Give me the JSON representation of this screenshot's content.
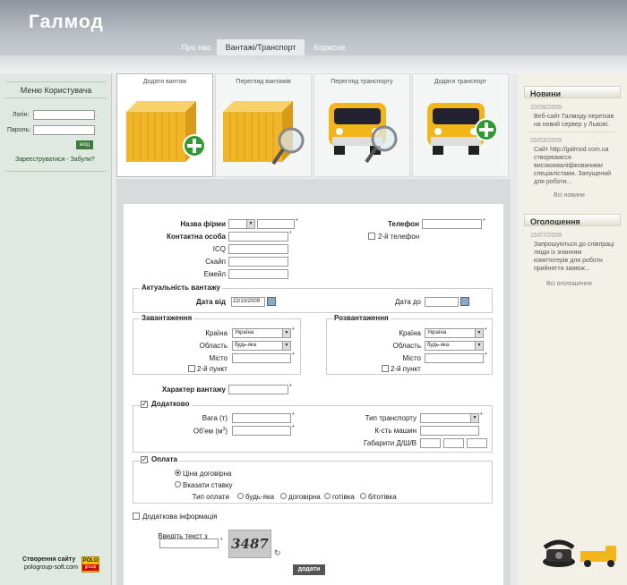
{
  "site": {
    "logo": "Галмод"
  },
  "nav": {
    "items": [
      "Про нас",
      "Вантажі/Транспорт",
      "Корисне"
    ]
  },
  "login": {
    "title": "Меню Користувача",
    "login_label": "Логін:",
    "password_label": "Пароль:",
    "submit": "вхід",
    "register": "Зареєструватися",
    "separator": "-",
    "forgot": "Забули?"
  },
  "footer": {
    "created": "Створення сайту",
    "site": "pologroup-soft.com",
    "badge_top": "POLO",
    "badge_bottom": "group"
  },
  "tiles": [
    {
      "label": "Додати вантаж",
      "icon": "container-add-icon"
    },
    {
      "label": "Перегляд вантажів",
      "icon": "container-search-icon"
    },
    {
      "label": "Перегляд транспорту",
      "icon": "truck-search-icon"
    },
    {
      "label": "Додати транспорт",
      "icon": "truck-add-icon"
    }
  ],
  "form": {
    "firm_label": "Назва фірми",
    "phone_label": "Телефон",
    "contact_label": "Контактна особа",
    "phone2_label": "2-й телефон",
    "icq_label": "ICQ",
    "skype_label": "Скайп",
    "email_label": "Емейл",
    "actuality": {
      "title": "Актуальність вантажу",
      "from_label": "Дата від",
      "from_value": "22/10/2009",
      "to_label": "Дата до"
    },
    "loading": {
      "title": "Завантаження",
      "country_label": "Країна",
      "country_value": "Україна",
      "region_label": "Область",
      "region_value": "будь-яка",
      "city_label": "Місто",
      "point2_label": "2-й пункт"
    },
    "unloading": {
      "title": "Розвантаження",
      "country_label": "Країна",
      "country_value": "Україна",
      "region_label": "Область",
      "region_value": "будь-яка",
      "city_label": "Місто",
      "point2_label": "2-й пункт"
    },
    "cargo_label": "Характер вантажу",
    "extra": {
      "title": "Додатково",
      "weight_label": "Вага (т)",
      "volume_label": "Об'ем (м",
      "volume_sup": "3",
      "volume_close": ")",
      "transport_label": "Тип транспорту",
      "count_label": "К-сть машин",
      "dims_label": "Габарити Д/Ш/В"
    },
    "payment": {
      "title": "Оплата",
      "opt1": "Ціна договірна",
      "opt2": "Вказати ставку",
      "type_label": "Тип оплати",
      "types": [
        "будь-яка",
        "договірна",
        "готівка",
        "б/готівка"
      ]
    },
    "more_info": "Додаткова інформація",
    "captcha_label": "Введіть текст з малюнку",
    "captcha_text": "3487",
    "submit": "додати"
  },
  "news": {
    "title": "Новини",
    "items": [
      {
        "date": "20/08/2009",
        "text": "Веб-сайт Галмоду переїхав на новий сервер у Львові."
      },
      {
        "date": "05/03/2009",
        "text": "Сайт http://galmod.com.ua створюваєся висококваліфікованими спеціалістами. Запущений для роботи..."
      }
    ],
    "more": "Всі новини"
  },
  "ads": {
    "title": "Оголошення",
    "items": [
      {
        "date": "15/07/2009",
        "text": "Запрошуються до співпраці люди із знанням комп'ютерів для роботи прийняття заявок..."
      }
    ],
    "more": "Всі оголошення"
  }
}
